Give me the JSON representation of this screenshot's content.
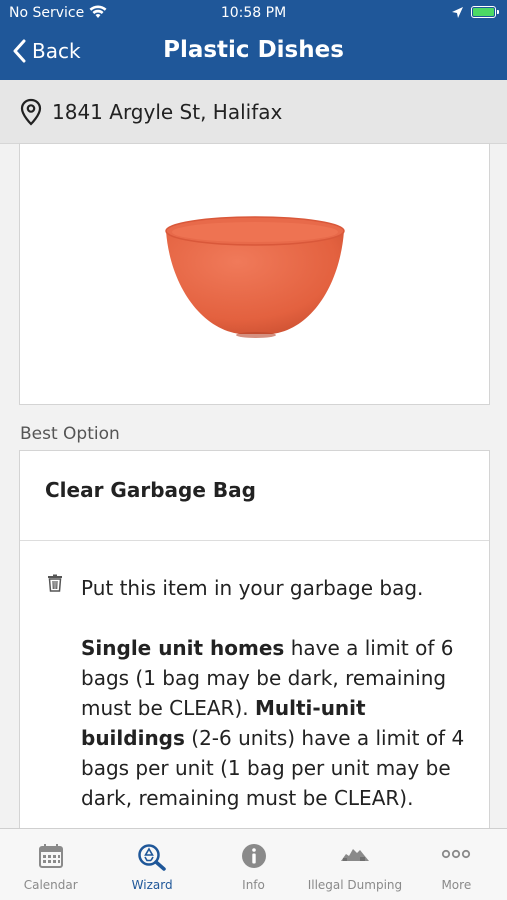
{
  "status_bar": {
    "carrier": "No Service",
    "time": "10:58 PM"
  },
  "nav": {
    "back_label": "Back",
    "title": "Plastic Dishes"
  },
  "address": {
    "text": "1841 Argyle St, Halifax"
  },
  "item_image": {
    "subject": "orange plastic bowl",
    "color": "#e8684a"
  },
  "best_option": {
    "section_label": "Best Option",
    "title": "Clear Garbage Bag",
    "line1": "Put this item in your garbage bag.",
    "single_unit_bold": "Single unit homes",
    "single_unit_text": " have a limit of 6 bags (1 bag may be dark, remaining must be CLEAR). ",
    "multi_unit_bold": "Multi-unit buildings",
    "multi_unit_text": " (2-6 units) have a limit of 4 bags per unit (1 bag per unit may be dark, remaining must be CLEAR)."
  },
  "tabs": [
    {
      "label": "Calendar",
      "icon": "calendar-icon",
      "active": false
    },
    {
      "label": "Wizard",
      "icon": "recycle-search-icon",
      "active": true
    },
    {
      "label": "Info",
      "icon": "info-icon",
      "active": false
    },
    {
      "label": "Illegal Dumping",
      "icon": "dumping-icon",
      "active": false
    },
    {
      "label": "More",
      "icon": "more-icon",
      "active": false
    }
  ],
  "colors": {
    "brand": "#1f5799",
    "tab_inactive": "#8a8a8a"
  }
}
